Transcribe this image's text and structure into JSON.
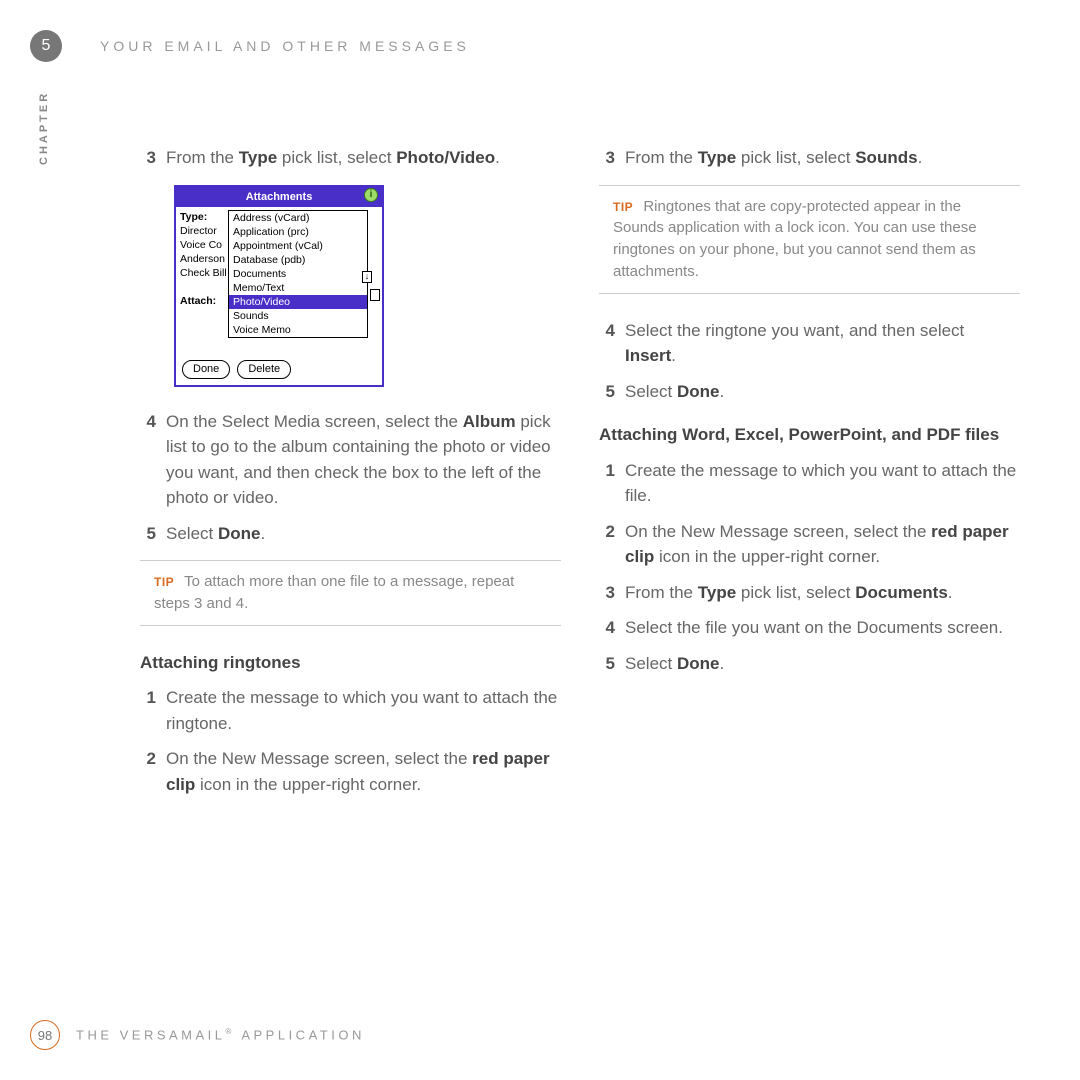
{
  "chapter": {
    "number": "5",
    "label": "CHAPTER"
  },
  "header": {
    "title": "YOUR EMAIL AND OTHER MESSAGES"
  },
  "footer": {
    "page": "98",
    "app_prefix": "THE VERSAMAIL",
    "app_suffix": " APPLICATION",
    "reg": "®"
  },
  "left": {
    "s3_a": "From the ",
    "s3_b": "Type",
    "s3_c": " pick list, select ",
    "s3_d": "Photo/Video",
    "s3_e": ".",
    "s4_a": "On the Select Media screen, select the ",
    "s4_b": "Album",
    "s4_c": " pick list to go to the album containing the photo or video you want, and then check the box to the left of the photo or video.",
    "s5_a": "Select ",
    "s5_b": "Done",
    "s5_c": ".",
    "tip_label": "TIP",
    "tip_text": "To attach more than one file to a message, repeat steps 3 and 4.",
    "ring_head": "Attaching ringtones",
    "r1": "Create the message to which you want to attach the ringtone.",
    "r2_a": "On the New Message screen, select the ",
    "r2_b": "red paper clip",
    "r2_c": "       icon in the upper-right corner."
  },
  "right": {
    "s3_a": "From the ",
    "s3_b": "Type",
    "s3_c": " pick list, select ",
    "s3_d": "Sounds",
    "s3_e": ".",
    "tip_label": "TIP",
    "tip_text": "Ringtones that are copy-protected appear in the Sounds application with a lock icon. You can use these ringtones on your phone, but you cannot send them as attachments.",
    "s4_a": "Select the ringtone you want, and then select ",
    "s4_b": "Insert",
    "s4_c": ".",
    "s5_a": "Select ",
    "s5_b": "Done",
    "s5_c": ".",
    "doc_head": "Attaching Word, Excel, PowerPoint, and PDF files",
    "d1": "Create the message to which you want to attach the file.",
    "d2_a": "On the New Message screen, select the ",
    "d2_b": "red paper clip",
    "d2_c": "       icon in the upper-right corner.",
    "d3_a": "From the ",
    "d3_b": "Type",
    "d3_c": " pick list, select ",
    "d3_d": "Documents",
    "d3_e": ".",
    "d4": "Select the file you want on the Documents screen.",
    "d5_a": "Select ",
    "d5_b": "Done",
    "d5_c": "."
  },
  "ui": {
    "title": "Attachments",
    "info": "i",
    "side": {
      "type": "Type:",
      "director": "Director",
      "voiceco": "Voice Co",
      "anderson": "Anderson",
      "checkbill": "Check Bill",
      "attach": "Attach:"
    },
    "options": [
      "Address (vCard)",
      "Application (prc)",
      "Appointment (vCal)",
      "Database (pdb)",
      "Documents",
      "Memo/Text",
      "Photo/Video",
      "Sounds",
      "Voice Memo"
    ],
    "arrow": "↓",
    "done": "Done",
    "delete": "Delete"
  }
}
